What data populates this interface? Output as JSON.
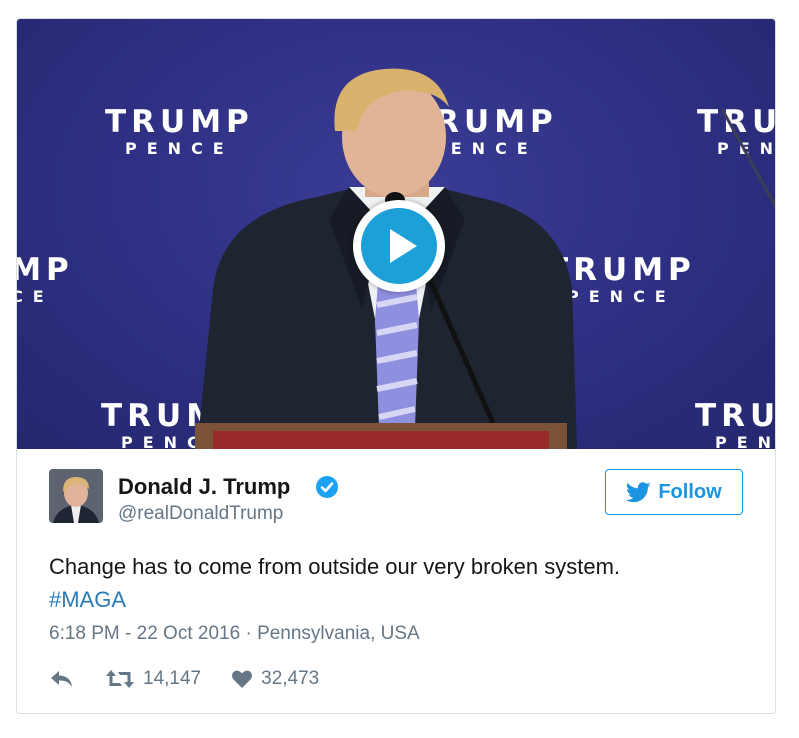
{
  "media": {
    "banner_title": "TRUMP",
    "banner_subtitle": "PENCE",
    "play_icon": "play-icon",
    "colors": {
      "backdrop": "#2e2f82",
      "play": "#1d9fd8"
    }
  },
  "author": {
    "name": "Donald J. Trump",
    "handle": "@realDonaldTrump",
    "verified_icon": "verified-badge-icon",
    "avatar_icon": "avatar"
  },
  "follow": {
    "label": "Follow",
    "icon": "twitter-bird-icon",
    "color": "#1b95e0"
  },
  "tweet": {
    "text": "Change has to come from outside our very broken system.",
    "hashtag": "#MAGA",
    "hashtag_color": "#2b7bb9"
  },
  "meta": {
    "time": "6:18 PM - 22 Oct 2016",
    "separator": " · ",
    "location": "Pennsylvania, USA"
  },
  "actions": {
    "reply_icon": "reply-icon",
    "retweet_icon": "retweet-icon",
    "retweets": "14,147",
    "like_icon": "heart-icon",
    "likes": "32,473"
  }
}
